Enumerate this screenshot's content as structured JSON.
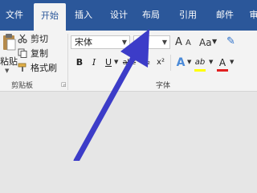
{
  "tabs": [
    {
      "label": "文件"
    },
    {
      "label": "开始"
    },
    {
      "label": "插入"
    },
    {
      "label": "设计"
    },
    {
      "label": "布局"
    },
    {
      "label": "引用"
    },
    {
      "label": "邮件"
    },
    {
      "label": "审"
    }
  ],
  "clipboard": {
    "paste_label": "粘贴",
    "cut_label": "剪切",
    "copy_label": "复制",
    "format_painter_label": "格式刷",
    "group_label": "剪贴板"
  },
  "font": {
    "font_name": "宋体",
    "font_size": "",
    "grow_label": "A",
    "shrink_label": "A",
    "case_label": "Aa",
    "bold_label": "B",
    "italic_label": "I",
    "underline_label": "U",
    "strike_label": "abc",
    "subscript_label": "x₂",
    "superscript_label": "x²",
    "text_effect_label": "A",
    "highlight_label": "ab",
    "font_color_label": "A",
    "group_label": "字体"
  },
  "colors": {
    "tabbar": "#2b579a",
    "annotation_arrow": "#3c3cc8",
    "highlight_bar": "#ffff00",
    "font_color_bar": "#e02020"
  }
}
